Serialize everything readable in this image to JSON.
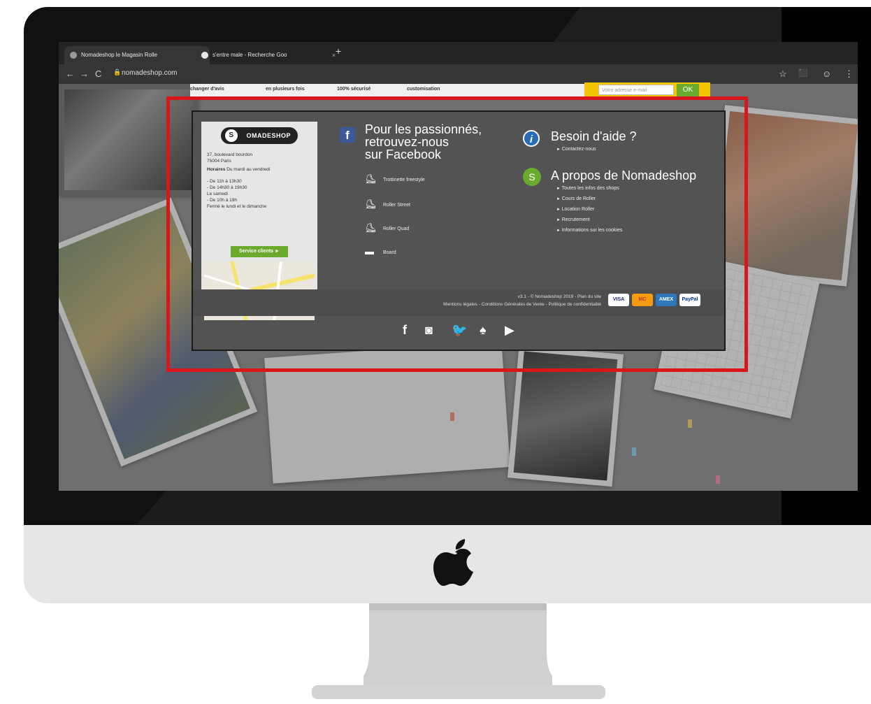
{
  "browser": {
    "tabs": [
      {
        "title": "Nomadeshop le Magasin Rolle",
        "close": "×"
      },
      {
        "title": "s'entre male - Recherche Goo",
        "close": "×"
      }
    ],
    "new_tab": "+",
    "nav": {
      "back": "←",
      "forward": "→",
      "reload": "C"
    },
    "lock": "🔒",
    "url": "nomadeshop.com",
    "icons": {
      "star": "☆",
      "extension": "⬛",
      "profile": "☺",
      "menu": "⋮"
    }
  },
  "top_strip": {
    "items": [
      "changer d'avis",
      "en plusieurs fois",
      "100% sécurisé",
      "customisation"
    ],
    "newsletter_placeholder": "Votre adresse e-mail",
    "ok_label": "OK"
  },
  "footer": {
    "logo_text": "OMADESHOP",
    "address_lines": [
      "37, boulevard bourdon",
      "75004 Paris"
    ],
    "hours_title": "Horaires",
    "hours_range": "Du mardi au vendredi",
    "hours_lines": [
      "- De 11h à 13h30",
      "- De 14h30 à 19h30",
      "Le samedi",
      "- De 10h à 19h",
      "Fermé le lundi et le dimanche"
    ],
    "service_button": "Service clients ►",
    "facebook": {
      "line1": "Pour les passionnés,",
      "line2": "retrouvez-nous",
      "line3": "sur Facebook"
    },
    "categories": [
      "Trottinette freestyle",
      "Roller Street",
      "Roller Quad",
      "Board"
    ],
    "help_title": "Besoin d'aide ?",
    "help_links": [
      "Contactez-nous"
    ],
    "about_title": "A propos de Nomadeshop",
    "about_links": [
      "Toutes les infos des shops",
      "Cours de Roller",
      "Location Roller",
      "Recrutement",
      "Informations sur les cookies"
    ],
    "legal_line1": "v3.1 - © Nomadeshop 2019 - Plan du site",
    "legal_line2": "Mentions légales - Conditions Générales de Vente - Politique de confidentialité",
    "payments": [
      "VISA",
      "MC",
      "AMEX",
      "PayPal"
    ],
    "social_icons": [
      "facebook-icon",
      "instagram-icon",
      "twitter-icon",
      "snapchat-icon",
      "youtube-icon"
    ]
  },
  "colors": {
    "footer_bg": "#535353",
    "highlight": "#d8161b",
    "accent_green": "#6aab2d",
    "newsletter_yellow": "#f2c500"
  }
}
